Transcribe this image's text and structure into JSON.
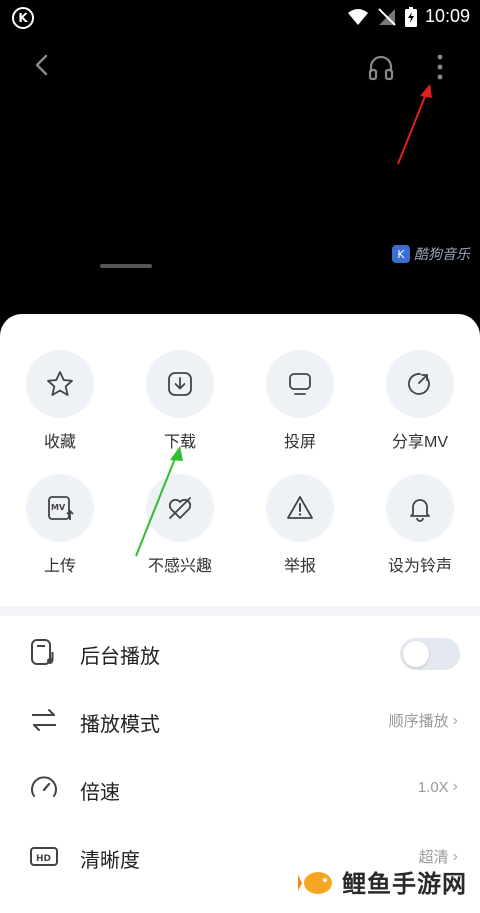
{
  "status_bar": {
    "time": "10:09",
    "app_badge": "K"
  },
  "video": {
    "watermark_text": "酷狗音乐",
    "watermark_icon_letter": "K"
  },
  "actions_row1": [
    {
      "label": "收藏",
      "icon": "star-icon"
    },
    {
      "label": "下载",
      "icon": "download-icon"
    },
    {
      "label": "投屏",
      "icon": "cast-screen-icon"
    },
    {
      "label": "分享MV",
      "icon": "share-icon"
    }
  ],
  "actions_row2": [
    {
      "label": "上传",
      "icon": "upload-mv-icon"
    },
    {
      "label": "不感兴趣",
      "icon": "not-interested-icon"
    },
    {
      "label": "举报",
      "icon": "report-warning-icon"
    },
    {
      "label": "设为铃声",
      "icon": "bell-icon"
    }
  ],
  "settings": [
    {
      "label": "后台播放",
      "icon": "background-play-icon",
      "type": "toggle",
      "enabled": false
    },
    {
      "label": "播放模式",
      "icon": "play-mode-icon",
      "value": "顺序播放"
    },
    {
      "label": "倍速",
      "icon": "speed-gauge-icon",
      "value": "1.0X"
    },
    {
      "label": "清晰度",
      "icon": "hd-icon",
      "value": "超清"
    }
  ],
  "site_watermark": "鲤鱼手游网",
  "colors": {
    "sheet_bg": "#ffffff",
    "icon_circle": "#eef1f6",
    "annotation_red": "#e02020",
    "annotation_green": "#2fbf2f"
  }
}
